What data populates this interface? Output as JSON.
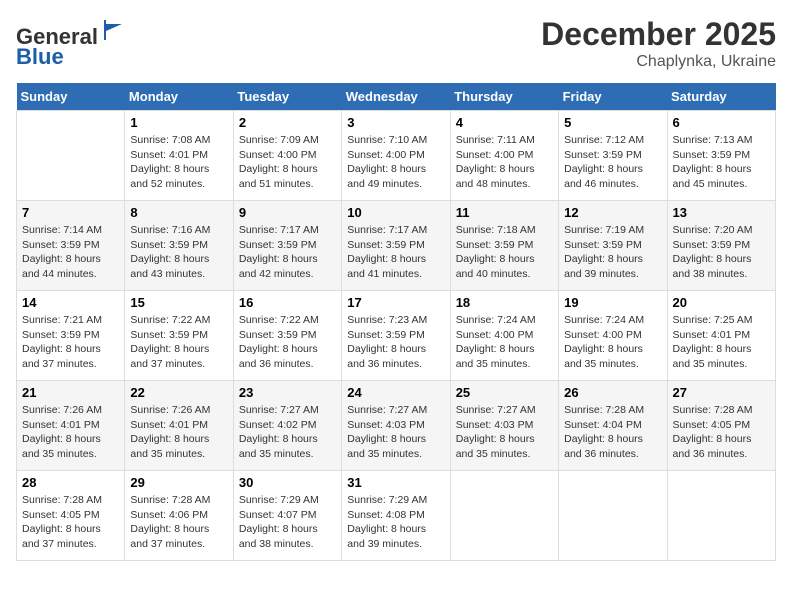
{
  "header": {
    "logo_line1": "General",
    "logo_line2": "Blue",
    "month_title": "December 2025",
    "location": "Chaplynka, Ukraine"
  },
  "days_of_week": [
    "Sunday",
    "Monday",
    "Tuesday",
    "Wednesday",
    "Thursday",
    "Friday",
    "Saturday"
  ],
  "weeks": [
    [
      {
        "num": "",
        "info": ""
      },
      {
        "num": "1",
        "info": "Sunrise: 7:08 AM\nSunset: 4:01 PM\nDaylight: 8 hours\nand 52 minutes."
      },
      {
        "num": "2",
        "info": "Sunrise: 7:09 AM\nSunset: 4:00 PM\nDaylight: 8 hours\nand 51 minutes."
      },
      {
        "num": "3",
        "info": "Sunrise: 7:10 AM\nSunset: 4:00 PM\nDaylight: 8 hours\nand 49 minutes."
      },
      {
        "num": "4",
        "info": "Sunrise: 7:11 AM\nSunset: 4:00 PM\nDaylight: 8 hours\nand 48 minutes."
      },
      {
        "num": "5",
        "info": "Sunrise: 7:12 AM\nSunset: 3:59 PM\nDaylight: 8 hours\nand 46 minutes."
      },
      {
        "num": "6",
        "info": "Sunrise: 7:13 AM\nSunset: 3:59 PM\nDaylight: 8 hours\nand 45 minutes."
      }
    ],
    [
      {
        "num": "7",
        "info": "Sunrise: 7:14 AM\nSunset: 3:59 PM\nDaylight: 8 hours\nand 44 minutes."
      },
      {
        "num": "8",
        "info": "Sunrise: 7:16 AM\nSunset: 3:59 PM\nDaylight: 8 hours\nand 43 minutes."
      },
      {
        "num": "9",
        "info": "Sunrise: 7:17 AM\nSunset: 3:59 PM\nDaylight: 8 hours\nand 42 minutes."
      },
      {
        "num": "10",
        "info": "Sunrise: 7:17 AM\nSunset: 3:59 PM\nDaylight: 8 hours\nand 41 minutes."
      },
      {
        "num": "11",
        "info": "Sunrise: 7:18 AM\nSunset: 3:59 PM\nDaylight: 8 hours\nand 40 minutes."
      },
      {
        "num": "12",
        "info": "Sunrise: 7:19 AM\nSunset: 3:59 PM\nDaylight: 8 hours\nand 39 minutes."
      },
      {
        "num": "13",
        "info": "Sunrise: 7:20 AM\nSunset: 3:59 PM\nDaylight: 8 hours\nand 38 minutes."
      }
    ],
    [
      {
        "num": "14",
        "info": "Sunrise: 7:21 AM\nSunset: 3:59 PM\nDaylight: 8 hours\nand 37 minutes."
      },
      {
        "num": "15",
        "info": "Sunrise: 7:22 AM\nSunset: 3:59 PM\nDaylight: 8 hours\nand 37 minutes."
      },
      {
        "num": "16",
        "info": "Sunrise: 7:22 AM\nSunset: 3:59 PM\nDaylight: 8 hours\nand 36 minutes."
      },
      {
        "num": "17",
        "info": "Sunrise: 7:23 AM\nSunset: 3:59 PM\nDaylight: 8 hours\nand 36 minutes."
      },
      {
        "num": "18",
        "info": "Sunrise: 7:24 AM\nSunset: 4:00 PM\nDaylight: 8 hours\nand 35 minutes."
      },
      {
        "num": "19",
        "info": "Sunrise: 7:24 AM\nSunset: 4:00 PM\nDaylight: 8 hours\nand 35 minutes."
      },
      {
        "num": "20",
        "info": "Sunrise: 7:25 AM\nSunset: 4:01 PM\nDaylight: 8 hours\nand 35 minutes."
      }
    ],
    [
      {
        "num": "21",
        "info": "Sunrise: 7:26 AM\nSunset: 4:01 PM\nDaylight: 8 hours\nand 35 minutes."
      },
      {
        "num": "22",
        "info": "Sunrise: 7:26 AM\nSunset: 4:01 PM\nDaylight: 8 hours\nand 35 minutes."
      },
      {
        "num": "23",
        "info": "Sunrise: 7:27 AM\nSunset: 4:02 PM\nDaylight: 8 hours\nand 35 minutes."
      },
      {
        "num": "24",
        "info": "Sunrise: 7:27 AM\nSunset: 4:03 PM\nDaylight: 8 hours\nand 35 minutes."
      },
      {
        "num": "25",
        "info": "Sunrise: 7:27 AM\nSunset: 4:03 PM\nDaylight: 8 hours\nand 35 minutes."
      },
      {
        "num": "26",
        "info": "Sunrise: 7:28 AM\nSunset: 4:04 PM\nDaylight: 8 hours\nand 36 minutes."
      },
      {
        "num": "27",
        "info": "Sunrise: 7:28 AM\nSunset: 4:05 PM\nDaylight: 8 hours\nand 36 minutes."
      }
    ],
    [
      {
        "num": "28",
        "info": "Sunrise: 7:28 AM\nSunset: 4:05 PM\nDaylight: 8 hours\nand 37 minutes."
      },
      {
        "num": "29",
        "info": "Sunrise: 7:28 AM\nSunset: 4:06 PM\nDaylight: 8 hours\nand 37 minutes."
      },
      {
        "num": "30",
        "info": "Sunrise: 7:29 AM\nSunset: 4:07 PM\nDaylight: 8 hours\nand 38 minutes."
      },
      {
        "num": "31",
        "info": "Sunrise: 7:29 AM\nSunset: 4:08 PM\nDaylight: 8 hours\nand 39 minutes."
      },
      {
        "num": "",
        "info": ""
      },
      {
        "num": "",
        "info": ""
      },
      {
        "num": "",
        "info": ""
      }
    ]
  ]
}
